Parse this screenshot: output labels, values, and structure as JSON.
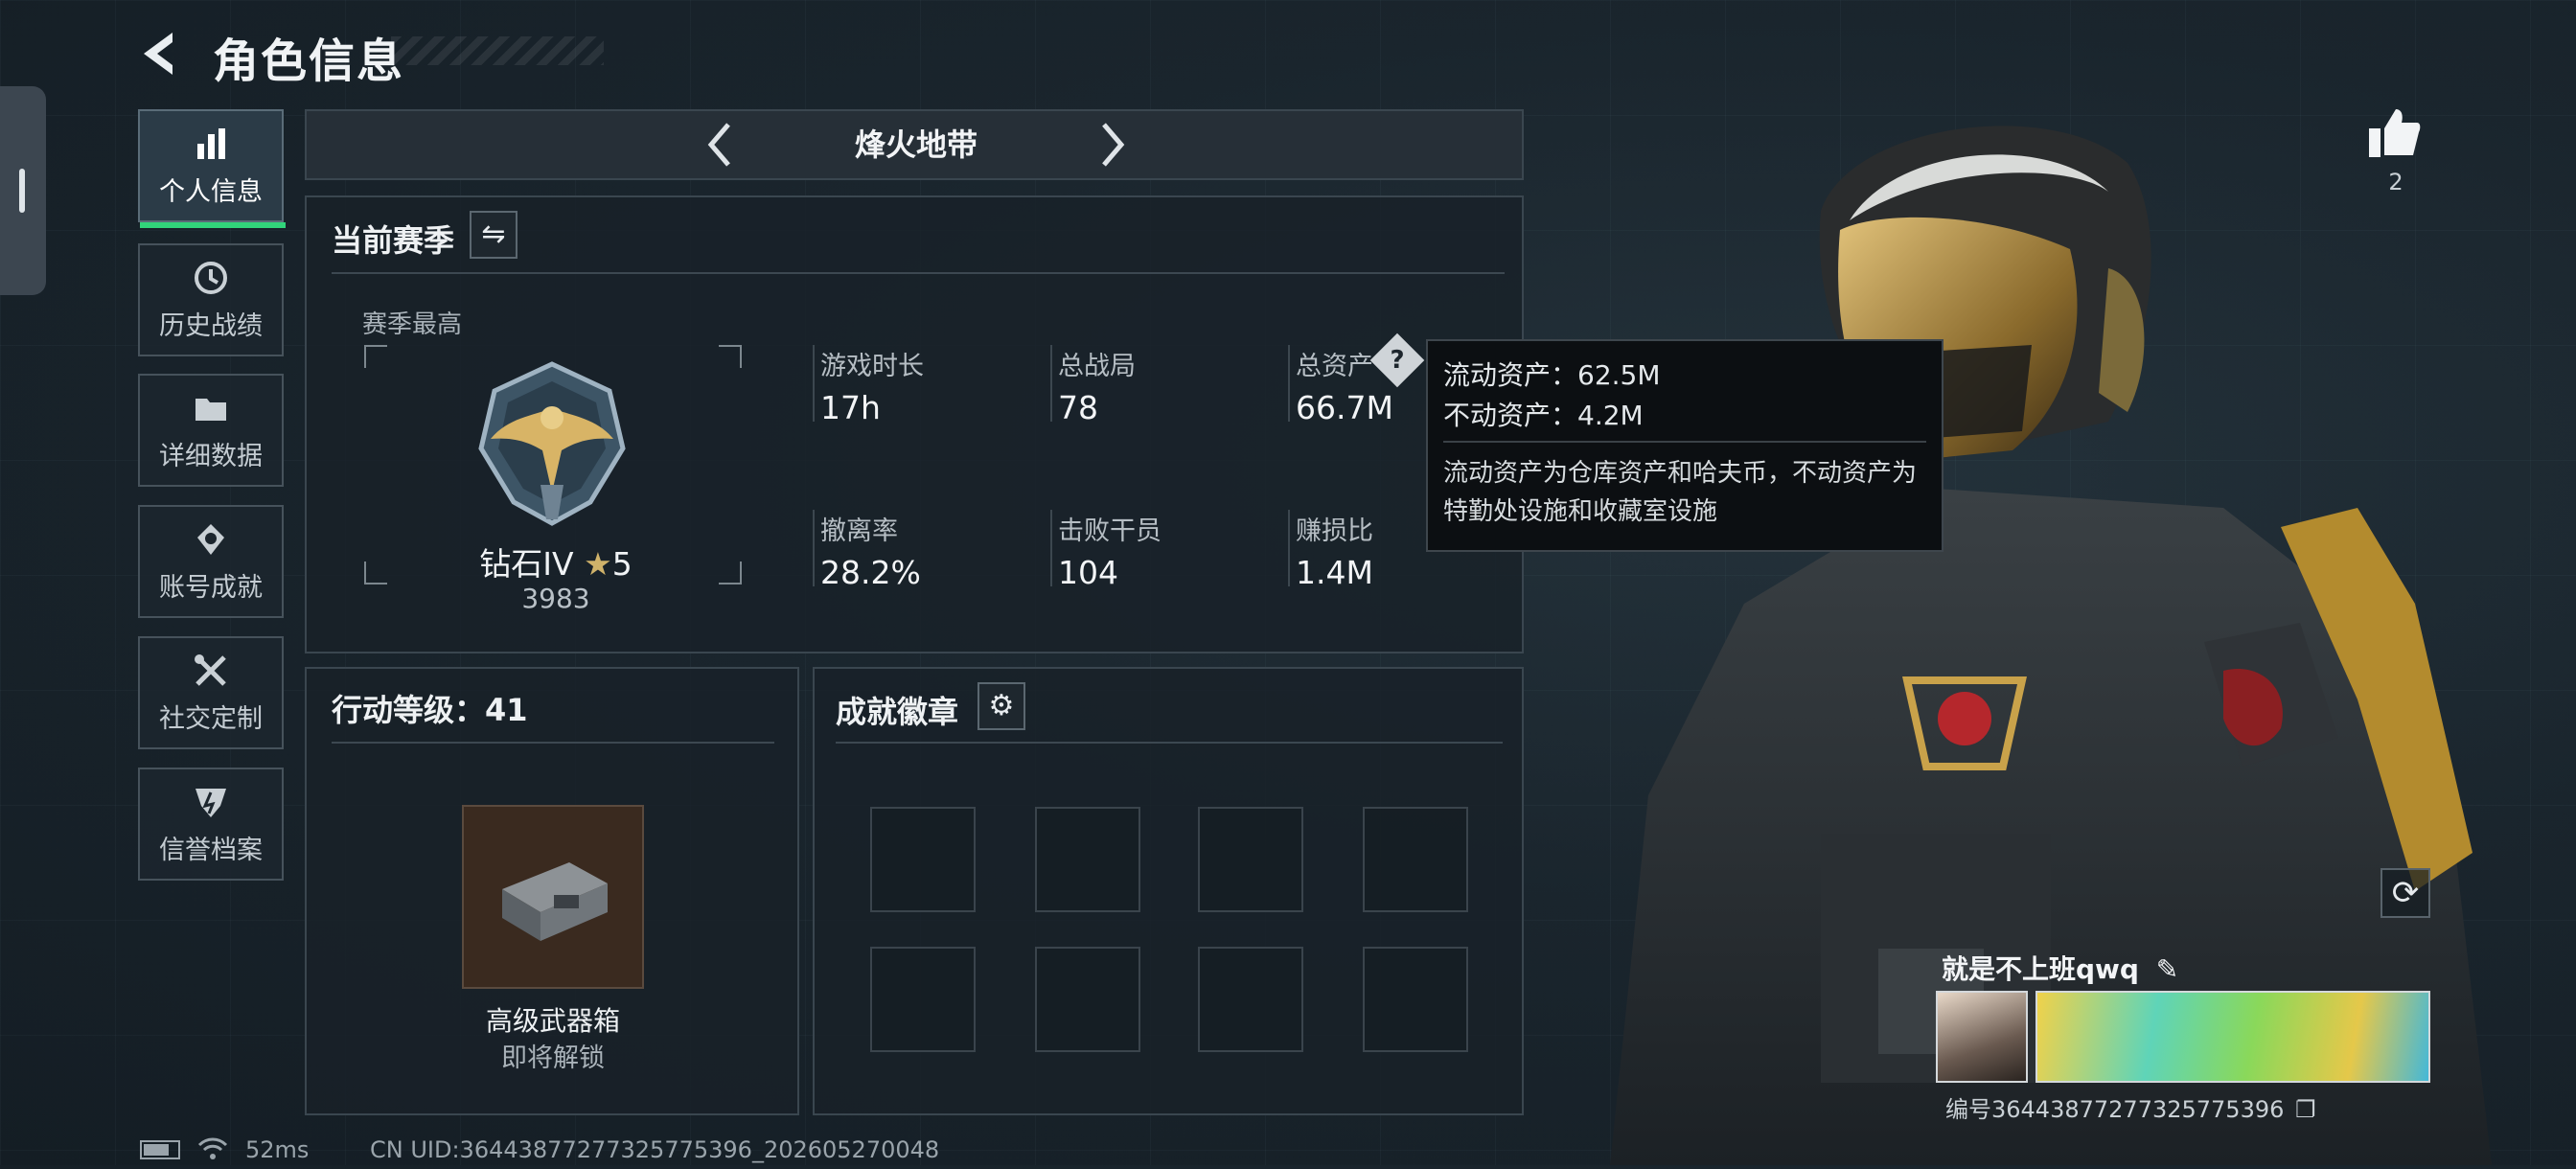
{
  "header": {
    "title": "角色信息"
  },
  "nav": {
    "items": [
      {
        "label": "个人信息",
        "icon": "bar-chart-icon",
        "active": true
      },
      {
        "label": "历史战绩",
        "icon": "history-icon",
        "active": false
      },
      {
        "label": "详细数据",
        "icon": "folder-icon",
        "active": false
      },
      {
        "label": "账号成就",
        "icon": "medal-icon",
        "active": false
      },
      {
        "label": "社交定制",
        "icon": "tools-icon",
        "active": false
      },
      {
        "label": "信誉档案",
        "icon": "shield-icon",
        "active": false
      }
    ]
  },
  "mode": {
    "title": "烽火地带"
  },
  "season": {
    "title": "当前赛季",
    "best_label": "赛季最高",
    "rank_name": "钻石IV",
    "rank_stars": "5",
    "rank_points": "3983",
    "stats": [
      {
        "label": "游戏时长",
        "value": "17h"
      },
      {
        "label": "总战局",
        "value": "78"
      },
      {
        "label": "总资产",
        "value": "66.7M"
      },
      {
        "label": "撤离率",
        "value": "28.2%"
      },
      {
        "label": "击败干员",
        "value": "104"
      },
      {
        "label": "赚损比",
        "value": "1.4M"
      }
    ]
  },
  "tooltip": {
    "liquid": "流动资产：62.5M",
    "fixed": "不动资产：4.2M",
    "description": "流动资产为仓库资产和哈夫币，不动资产为特勤处设施和收藏室设施"
  },
  "action_level": {
    "title": "行动等级：41",
    "reward_name": "高级武器箱",
    "reward_status": "即将解锁"
  },
  "badges": {
    "title": "成就徽章"
  },
  "profile": {
    "name": "就是不上班qwq",
    "id_text": "编号3644387727732577539​6",
    "likes": "2"
  },
  "footer": {
    "ping": "52ms",
    "uid": "CN UID:3644387727732577539​6_202605270048"
  },
  "colors": {
    "accent": "#31d47a",
    "gold": "#c9a24a"
  }
}
